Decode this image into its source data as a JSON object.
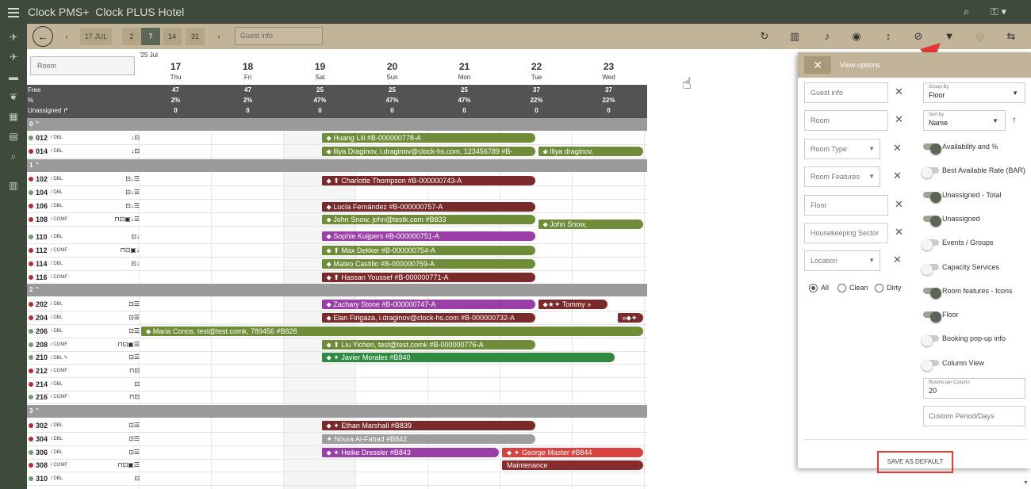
{
  "app": {
    "title": "Clock PMS+",
    "hotel": "Clock PLUS Hotel"
  },
  "toolbar": {
    "date": "17 JUL",
    "ranges": [
      "2",
      "7",
      "14",
      "31"
    ],
    "guest_placeholder": "Guest info"
  },
  "grid": {
    "room_placeholder": "Room",
    "month": "'25 Jul",
    "days": [
      {
        "d": "17",
        "w": "Thu"
      },
      {
        "d": "18",
        "w": "Fri"
      },
      {
        "d": "19",
        "w": "Sat"
      },
      {
        "d": "20",
        "w": "Sun"
      },
      {
        "d": "21",
        "w": "Mon"
      },
      {
        "d": "22",
        "w": "Tue"
      },
      {
        "d": "23",
        "w": "Wed"
      }
    ],
    "stat_labels": [
      "Free",
      "%",
      "Unassigned ↱"
    ],
    "free": [
      "47",
      "47",
      "25",
      "25",
      "25",
      "37",
      "37"
    ],
    "pct": [
      "2%",
      "2%",
      "47%",
      "47%",
      "47%",
      "22%",
      "22%"
    ],
    "unassigned": [
      "0",
      "0",
      "0",
      "0",
      "0",
      "0",
      "0"
    ],
    "floors": [
      "0 ⌃",
      "1 ⌃",
      "2 ⌃",
      "3 ⌃"
    ],
    "rooms": [
      {
        "n": "012",
        "t": "/ DBL",
        "c": "#6a9e6a",
        "i": "↓⊡"
      },
      {
        "n": "014",
        "t": "/ DBL",
        "c": "#b52d2d",
        "i": "↓⊡"
      },
      {
        "n": "102",
        "t": "/ DBL",
        "c": "#b52d2d",
        "i": "⊡↓☰"
      },
      {
        "n": "104",
        "t": "/ DBL",
        "c": "#6a9e6a",
        "i": "⊡↓☰"
      },
      {
        "n": "106",
        "t": "/ DBL",
        "c": "#b52d2d",
        "i": "⊡↓☰"
      },
      {
        "n": "108",
        "t": "/ COMF",
        "c": "#b52d2d",
        "i": "⊓⊡▣↓☰"
      },
      {
        "n": "110",
        "t": "/ DBL",
        "c": "#6a9e6a",
        "i": "⊡↓"
      },
      {
        "n": "112",
        "t": "/ COMF",
        "c": "#b52d2d",
        "i": "⊓⊡▣↓"
      },
      {
        "n": "114",
        "t": "/ DBL",
        "c": "#b52d2d",
        "i": "⊡↓"
      },
      {
        "n": "116",
        "t": "/ COMF",
        "c": "#b52d2d",
        "i": ""
      },
      {
        "n": "202",
        "t": "/ DBL",
        "c": "#b52d2d",
        "i": "⊡☰"
      },
      {
        "n": "204",
        "t": "/ DBL",
        "c": "#b52d2d",
        "i": "⊡☰"
      },
      {
        "n": "206",
        "t": "/ DBL",
        "c": "#6a9e6a",
        "i": "⊡☰"
      },
      {
        "n": "208",
        "t": "/ COMF",
        "c": "#6a9e6a",
        "i": "⊓⊡▣☰"
      },
      {
        "n": "210",
        "t": "/ DBL ✎",
        "c": "#6a9e6a",
        "i": "⊡☰"
      },
      {
        "n": "212",
        "t": "/ COMF",
        "c": "#b52d2d",
        "i": "⊓⊡"
      },
      {
        "n": "214",
        "t": "/ DBL",
        "c": "#b52d2d",
        "i": "⊡"
      },
      {
        "n": "216",
        "t": "/ COMF",
        "c": "#6a9e6a",
        "i": "⊓⊡"
      },
      {
        "n": "302",
        "t": "/ DBL",
        "c": "#b52d2d",
        "i": "⊡☰"
      },
      {
        "n": "304",
        "t": "/ DBL",
        "c": "#b52d2d",
        "i": "⊡☰"
      },
      {
        "n": "306",
        "t": "/ DBL",
        "c": "#6a9e6a",
        "i": "⊡☰"
      },
      {
        "n": "308",
        "t": "/ COMF",
        "c": "#b52d2d",
        "i": "⊓⊡▣☰"
      },
      {
        "n": "310",
        "t": "/ DBL",
        "c": "#6a9e6a",
        "i": "⊡"
      }
    ],
    "bookings": [
      {
        "text": "⬥ Huang Lili #B-000000778-A",
        "color": "#6f8c39"
      },
      {
        "text": "⬥ Iliya Draginov, i.draginov@clock-hs.com, 123456789 #B-",
        "color": "#6f8c39"
      },
      {
        "text": "⬥ Iliya draginov,",
        "color": "#6f8c39"
      },
      {
        "text": "⬥ ⬆ Charlotte Thompson #B-000000743-A",
        "color": "#7a2a2a"
      },
      {
        "text": "⬥ Lucía Fernández #B-000000757-A",
        "color": "#7a2a2a"
      },
      {
        "text": "⬥ John Snow, john@testk.com #B833",
        "color": "#6f8c39"
      },
      {
        "text": "⬥ John Snow,",
        "color": "#6f8c39"
      },
      {
        "text": "⬥ Sophie Kuijpers #B-000000751-A",
        "color": "#9b3fa8"
      },
      {
        "text": "⬥ ⬆ Max Dekker #B-000000754-A",
        "color": "#6f8c39"
      },
      {
        "text": "⬥ Mateo Castillo #B-000000759-A",
        "color": "#6f8c39"
      },
      {
        "text": "⬥ ⬆ Hassan Youssef #B-000000771-A",
        "color": "#7a2a2a"
      },
      {
        "text": "⬥ Zachary Stone #B-000000747-A",
        "color": "#9b3fa8"
      },
      {
        "text": "⬥★✦ Tommy »",
        "color": "#7a2a2a"
      },
      {
        "text": "⬥ Elan Firigaza, i.draginov@clock-hs.com #B-000000732-A",
        "color": "#7a2a2a"
      },
      {
        "text": "»⬥✦",
        "color": "#7a2a2a"
      },
      {
        "text": "⬥ Maria Conos, test@test.comk, 789456 #B828",
        "color": "#6f8c39"
      },
      {
        "text": "⬥ ⬆ Liu Yichen, test@test.comk #B-000000776-A",
        "color": "#6f8c39"
      },
      {
        "text": "⬥ ✦ Javier Morales #B840",
        "color": "#2e8b3f"
      },
      {
        "text": "⬥ ✦ Ethan Marshall #B839",
        "color": "#7a2a2a"
      },
      {
        "text": "✦ Noura Al-Fahad #B842",
        "color": "#9e9e9e"
      },
      {
        "text": "⬥ ✦ Heike Dressler #B843",
        "color": "#9b3fa8"
      },
      {
        "text": "⬥ ✦ George Master #B844",
        "color": "#d9423e"
      },
      {
        "text": "Maintenance",
        "color": "#8a2a2a"
      }
    ]
  },
  "view": {
    "title": "View options",
    "filters": [
      "Guest info",
      "Room",
      "Room Type",
      "Room Features",
      "Floor",
      "Housekeeping Sector",
      "Location"
    ],
    "radio": [
      "All",
      "Clean",
      "Dirty"
    ],
    "group_label": "Group By",
    "group_value": "Floor",
    "sort_label": "Sort by",
    "sort_value": "Name",
    "toggles": [
      {
        "label": "Availability and %",
        "on": true
      },
      {
        "label": "Best Available Rate (BAR)",
        "on": false
      },
      {
        "label": "Unassigned - Total",
        "on": true
      },
      {
        "label": "Unassigned",
        "on": true
      },
      {
        "label": "Events / Groups",
        "on": false
      },
      {
        "label": "Capacity Services",
        "on": false
      },
      {
        "label": "Room features - Icons",
        "on": true
      },
      {
        "label": "Floor",
        "on": true
      },
      {
        "label": "Booking pop-up info",
        "on": false
      },
      {
        "label": "Column View",
        "on": false
      }
    ],
    "rooms_per_col_label": "Rooms per Column",
    "rooms_per_col": "20",
    "custom_period": "Custom Period/Days",
    "save": "SAVE AS DEFAULT"
  },
  "colors": {
    "topbar": "#3e4a3b",
    "toolbar": "#c2b498",
    "annotation": "#e53935"
  }
}
